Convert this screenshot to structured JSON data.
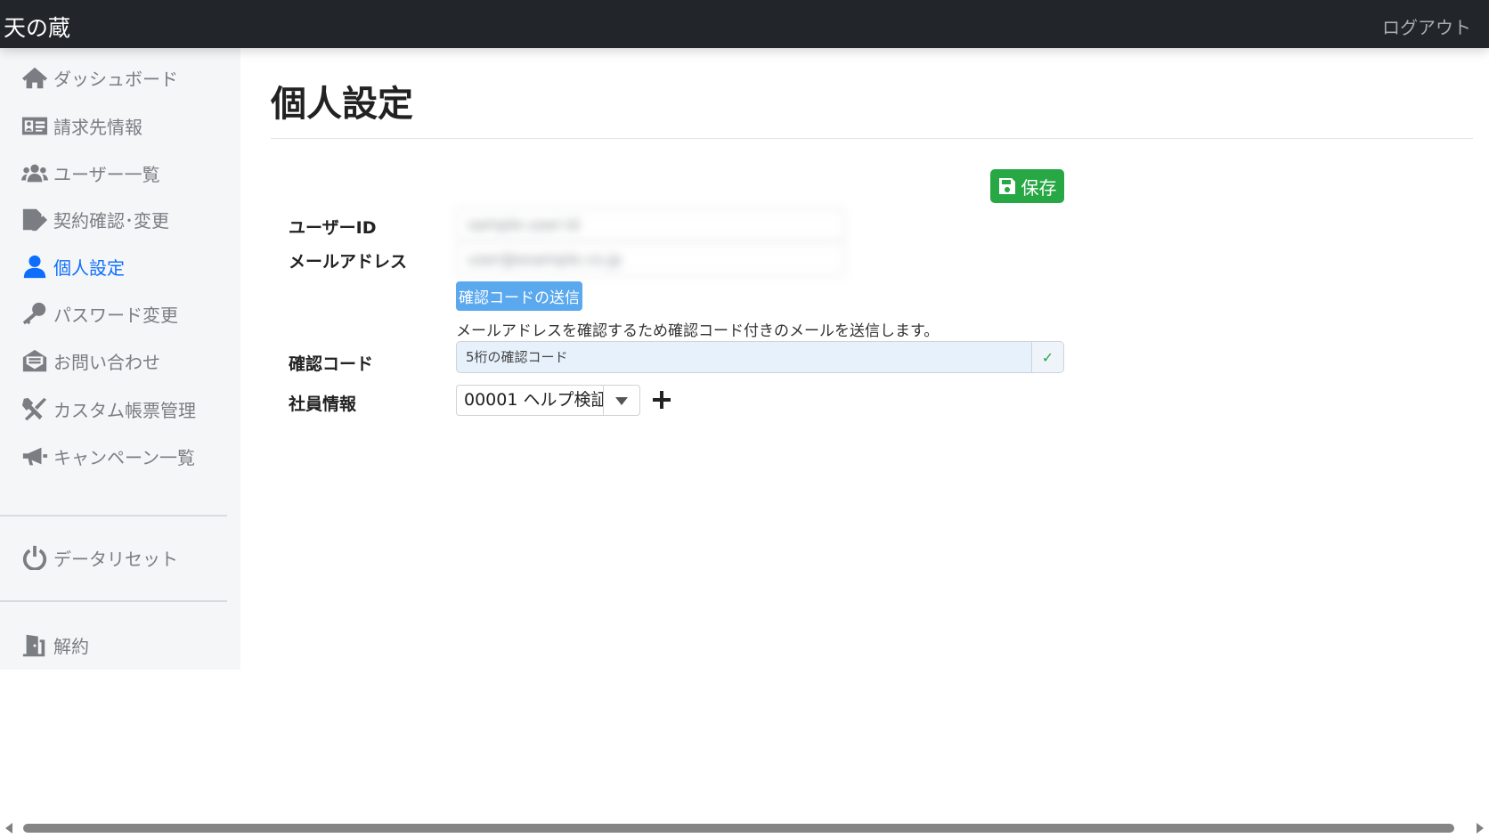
{
  "header": {
    "brand": "天の蔵",
    "logout_label": "ログアウト",
    "background_color": "#222529"
  },
  "sidebar": {
    "items": [
      {
        "label": "ダッシュボード",
        "icon": "home-icon"
      },
      {
        "label": "請求先情報",
        "icon": "id-card-icon"
      },
      {
        "label": "ユーザー一覧",
        "icon": "users-icon"
      },
      {
        "label": "契約確認･変更",
        "icon": "file-signature-icon"
      },
      {
        "label": "個人設定",
        "icon": "user-icon",
        "active": true
      },
      {
        "label": "パスワード変更",
        "icon": "key-icon"
      },
      {
        "label": "お問い合わせ",
        "icon": "envelope-open-icon"
      },
      {
        "label": "カスタム帳票管理",
        "icon": "tools-icon"
      },
      {
        "label": "キャンペーン一覧",
        "icon": "megaphone-icon"
      }
    ],
    "data_reset": {
      "label": "データリセット",
      "icon": "power-icon"
    },
    "cancel": {
      "label": "解約",
      "icon": "door-icon"
    },
    "active_color": "#0d6efd"
  },
  "main": {
    "title": "個人設定",
    "save_label": "保存",
    "save_color": "#28a745",
    "user_id": {
      "label": "ユーザーID",
      "value": "sample-user-id"
    },
    "email": {
      "label": "メールアドレス",
      "value": "user@example.co.jp"
    },
    "send_code_label": "確認コードの送信",
    "send_code_color": "#5aa8ee",
    "help_text": "メールアドレスを確認するため確認コード付きのメールを送信します。",
    "code": {
      "label": "確認コード",
      "placeholder": "5桁の確認コード",
      "check": "✓"
    },
    "employee": {
      "label": "社員情報",
      "value": "00001 ヘルプ検証"
    }
  }
}
